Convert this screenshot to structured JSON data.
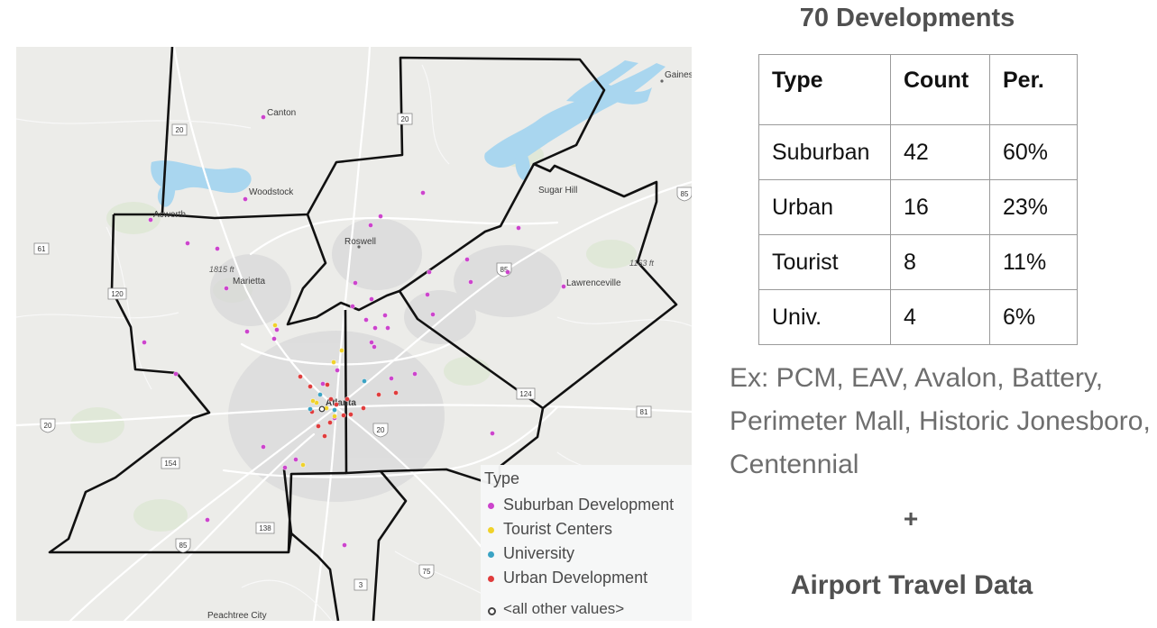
{
  "map": {
    "places": {
      "canton": "Canton",
      "woodstock": "Woodstock",
      "acworth": "Acworth",
      "marietta": "Marietta",
      "roswell": "Roswell",
      "sugar_hill": "Sugar Hill",
      "lawrenceville": "Lawrenceville",
      "atlanta": "Atlanta",
      "peachtree_city": "Peachtree City",
      "gaines": "Gaines"
    },
    "elevations": {
      "elev1": "1815 ft",
      "elev2": "1163 ft"
    },
    "shields": {
      "h20a": "20",
      "h20b": "20",
      "h61": "61",
      "h120": "120",
      "h20c": "20",
      "h154": "154",
      "h138": "138",
      "h85a": "85",
      "h85b": "85",
      "h85c": "85",
      "h124": "124",
      "h81": "81",
      "h75": "75",
      "h3": "3",
      "h20d": "20"
    }
  },
  "legend": {
    "title": "Type",
    "items": [
      {
        "label": "Suburban Development",
        "color": "#cc44cc"
      },
      {
        "label": "Tourist Centers",
        "color": "#f0d22a"
      },
      {
        "label": "University",
        "color": "#3aa3c4"
      },
      {
        "label": "Urban Development",
        "color": "#e03c3c"
      },
      {
        "label": "<all other values>",
        "color": "#444444"
      }
    ]
  },
  "summary": {
    "title": "70 Developments",
    "table": {
      "headers": [
        "Type",
        "Count",
        "Per."
      ],
      "rows": [
        [
          "Suburban",
          "42",
          "60%"
        ],
        [
          "Urban",
          "16",
          "23%"
        ],
        [
          "Tourist",
          "8",
          "11%"
        ],
        [
          "Univ.",
          "4",
          "6%"
        ]
      ]
    },
    "examples": "Ex: PCM, EAV, Avalon, Battery, Perimeter Mall, Historic Jonesboro, Centennial",
    "plus": "+",
    "airport": "Airport Travel Data"
  },
  "colors": {
    "suburban": "#cc44cc",
    "tourist": "#f0d22a",
    "university": "#3aa3c4",
    "urban": "#e03c3c",
    "water": "#a9d6ef",
    "boundary": "#111111"
  }
}
